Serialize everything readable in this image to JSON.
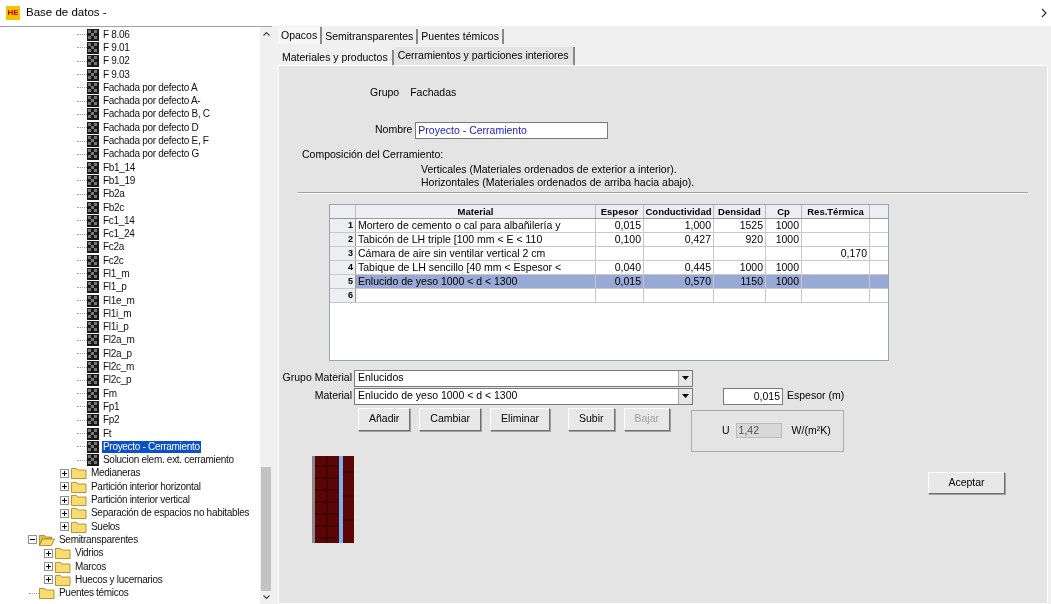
{
  "window": {
    "logo": "HE",
    "title": "Base de datos -"
  },
  "tree": [
    {
      "children": [
        {
          "children": [
            {
              "children": [
                {
                  "children": [
                    {
                      "label": "F 8.06",
                      "kind": "leaf",
                      "selected": false
                    },
                    {
                      "label": "F 9.01",
                      "kind": "leaf",
                      "selected": false
                    },
                    {
                      "label": "F 9.02",
                      "kind": "leaf",
                      "selected": false
                    },
                    {
                      "label": "F 9.03",
                      "kind": "leaf",
                      "selected": false
                    },
                    {
                      "label": "Fachada por defecto A",
                      "kind": "leaf",
                      "selected": false
                    },
                    {
                      "label": "Fachada por defecto A-",
                      "kind": "leaf",
                      "selected": false
                    },
                    {
                      "label": "Fachada por defecto B, C",
                      "kind": "leaf",
                      "selected": false
                    },
                    {
                      "label": "Fachada por defecto D",
                      "kind": "leaf",
                      "selected": false
                    },
                    {
                      "label": "Fachada por defecto E, F",
                      "kind": "leaf",
                      "selected": false
                    },
                    {
                      "label": "Fachada por defecto G",
                      "kind": "leaf",
                      "selected": false
                    },
                    {
                      "label": "Fb1_14",
                      "kind": "leaf",
                      "selected": false
                    },
                    {
                      "label": "Fb1_19",
                      "kind": "leaf",
                      "selected": false
                    },
                    {
                      "label": "Fb2a",
                      "kind": "leaf",
                      "selected": false
                    },
                    {
                      "label": "Fb2c",
                      "kind": "leaf",
                      "selected": false
                    },
                    {
                      "label": "Fc1_14",
                      "kind": "leaf",
                      "selected": false
                    },
                    {
                      "label": "Fc1_24",
                      "kind": "leaf",
                      "selected": false
                    },
                    {
                      "label": "Fc2a",
                      "kind": "leaf",
                      "selected": false
                    },
                    {
                      "label": "Fc2c",
                      "kind": "leaf",
                      "selected": false
                    },
                    {
                      "label": "Fl1_m",
                      "kind": "leaf",
                      "selected": false
                    },
                    {
                      "label": "Fl1_p",
                      "kind": "leaf",
                      "selected": false
                    },
                    {
                      "label": "Fl1e_m",
                      "kind": "leaf",
                      "selected": false
                    },
                    {
                      "label": "Fl1i_m",
                      "kind": "leaf",
                      "selected": false
                    },
                    {
                      "label": "Fl1i_p",
                      "kind": "leaf",
                      "selected": false
                    },
                    {
                      "label": "Fl2a_m",
                      "kind": "leaf",
                      "selected": false
                    },
                    {
                      "label": "Fl2a_p",
                      "kind": "leaf",
                      "selected": false
                    },
                    {
                      "label": "Fl2c_m",
                      "kind": "leaf",
                      "selected": false
                    },
                    {
                      "label": "Fl2c_p",
                      "kind": "leaf",
                      "selected": false
                    },
                    {
                      "label": "Fm",
                      "kind": "leaf",
                      "selected": false
                    },
                    {
                      "label": "Fp1",
                      "kind": "leaf",
                      "selected": false
                    },
                    {
                      "label": "Fp2",
                      "kind": "leaf",
                      "selected": false
                    },
                    {
                      "label": "Ft",
                      "kind": "leaf",
                      "selected": false
                    },
                    {
                      "label": "Proyecto - Cerramiento",
                      "kind": "leaf",
                      "selected": true
                    },
                    {
                      "label": "Solucion elem. ext. cerramiento",
                      "kind": "leaf",
                      "selected": false
                    }
                  ]
                },
                {
                  "label": "Medianeras",
                  "kind": "folder",
                  "expanded": false,
                  "selected": false
                },
                {
                  "label": "Partición interior horizontal",
                  "kind": "folder",
                  "expanded": false,
                  "selected": false
                },
                {
                  "label": "Partición interior vertical",
                  "kind": "folder",
                  "expanded": false,
                  "selected": false
                },
                {
                  "label": "Separación de espacios no habitables",
                  "kind": "folder",
                  "expanded": false,
                  "selected": false
                },
                {
                  "label": "Suelos",
                  "kind": "folder",
                  "expanded": false,
                  "selected": false
                }
              ]
            }
          ]
        },
        {
          "label": "Semitransparentes",
          "kind": "folder",
          "expanded": true,
          "selected": false,
          "children": [
            {
              "label": "Vidrios",
              "kind": "folder",
              "expanded": false,
              "selected": false
            },
            {
              "label": "Marcos",
              "kind": "folder",
              "expanded": false,
              "selected": false
            },
            {
              "label": "Huecos y lucernarios",
              "kind": "folder",
              "expanded": false,
              "selected": false
            }
          ]
        },
        {
          "label": "Puentes témicos",
          "kind": "folder",
          "selected": false
        }
      ]
    }
  ],
  "tabs": [
    {
      "label": "Opacos",
      "selected": true
    },
    {
      "label": "Semitransparentes",
      "selected": false
    },
    {
      "label": "Puentes témicos",
      "selected": false
    }
  ],
  "subtabs": [
    {
      "label": "Materiales y productos",
      "selected": false
    },
    {
      "label": "Cerramientos y particiones interiores",
      "selected": true
    }
  ],
  "form": {
    "group_label": "Grupo",
    "group_value": "Fachadas",
    "name_label": "Nombre",
    "name_value": "Proyecto - Cerramiento",
    "composition_title": "Composición del Cerramiento:",
    "composition_notes": [
      "Verticales (Materiales ordenados de exterior a interior).",
      "Horizontales (Materiales ordenados de arriba hacia abajo)."
    ]
  },
  "table": {
    "columns": [
      "Material",
      "Espesor",
      "Conductividad",
      "Densidad",
      "Cp",
      "Res.Térmica"
    ],
    "rows": [
      {
        "number": "1",
        "cells": [
          "Mortero de cemento o cal para albañilería y",
          "0,015",
          "1,000",
          "1525",
          "1000",
          null
        ],
        "selected": false
      },
      {
        "number": "2",
        "cells": [
          "Tabicón de LH triple [100 mm < E < 110",
          "0,100",
          "0,427",
          "920",
          "1000",
          null
        ],
        "selected": false
      },
      {
        "number": "3",
        "cells": [
          "Cámara de aire sin ventilar vertical 2 cm",
          null,
          null,
          null,
          null,
          "0,170"
        ],
        "selected": false
      },
      {
        "number": "4",
        "cells": [
          "Tabique de LH sencillo [40 mm < Espesor <",
          "0,040",
          "0,445",
          "1000",
          "1000",
          null
        ],
        "selected": false
      },
      {
        "number": "5",
        "cells": [
          "Enlucido de yeso 1000 < d < 1300",
          "0,015",
          "0,570",
          "1150",
          "1000",
          null
        ],
        "selected": true
      },
      {
        "number": "6",
        "cells": [
          null,
          null,
          null,
          null,
          null,
          null
        ],
        "selected": false
      }
    ]
  },
  "material_group": {
    "label": "Grupo Material",
    "value": "Enlucidos"
  },
  "material": {
    "label": "Material",
    "value": "Enlucido de yeso 1000 < d < 1300"
  },
  "thickness": {
    "value": "0,015",
    "label": "Espesor (m)"
  },
  "buttons": [
    {
      "label": "Añadir",
      "disabled": false
    },
    {
      "label": "Cambiar",
      "disabled": false
    },
    {
      "label": "Eliminar",
      "disabled": false
    },
    {
      "label": "Subir",
      "disabled": false
    },
    {
      "label": "Bajar",
      "disabled": true
    }
  ],
  "u_value": {
    "label": "U",
    "value": "1,42",
    "unit": "W/(m²K)"
  },
  "accept_button": "Aceptar"
}
